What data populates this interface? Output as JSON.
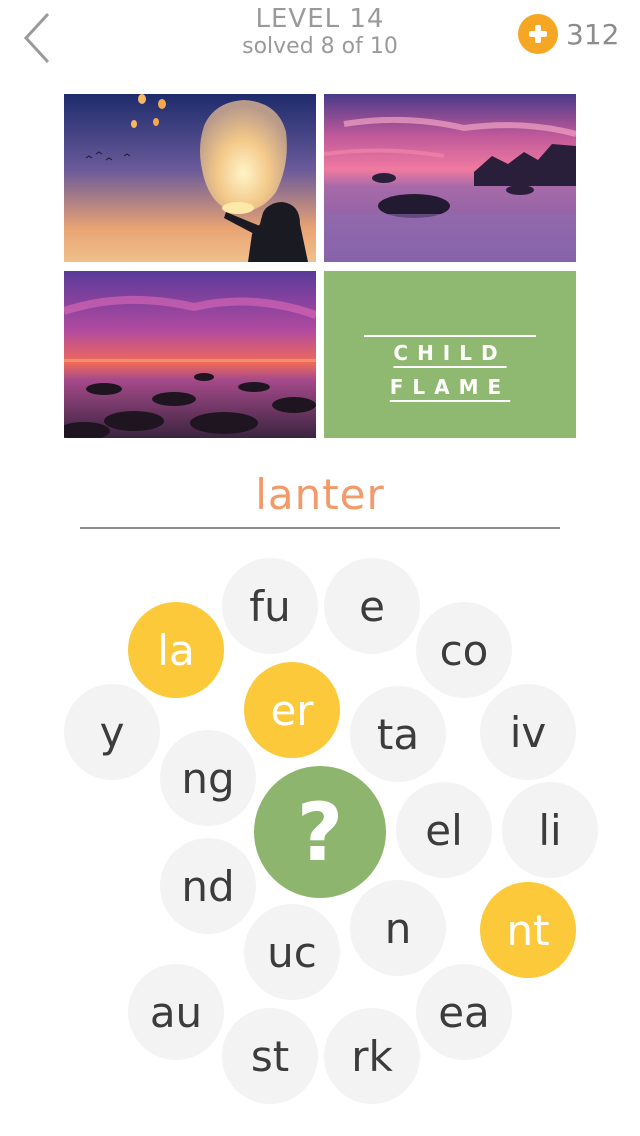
{
  "header": {
    "level": "LEVEL 14",
    "progress": "solved 8 of 10",
    "coins": "312"
  },
  "hint": {
    "line1": "CHILD",
    "line2": "FLAME"
  },
  "answer": "lanter",
  "tiles": {
    "fu": "fu",
    "e": "e",
    "la": "la",
    "co": "co",
    "y": "y",
    "er": "er",
    "ta": "ta",
    "iv": "iv",
    "ng": "ng",
    "el": "el",
    "li": "li",
    "nd": "nd",
    "n": "n",
    "nt": "nt",
    "uc": "uc",
    "au": "au",
    "ea": "ea",
    "st": "st",
    "rk": "rk"
  },
  "help_symbol": "?",
  "colors": {
    "selected_tile": "#fcc93b",
    "tile": "#f3f3f3",
    "answer_text": "#f29a6a",
    "hint_tile": "#8fb870",
    "coin": "#f5a623"
  }
}
